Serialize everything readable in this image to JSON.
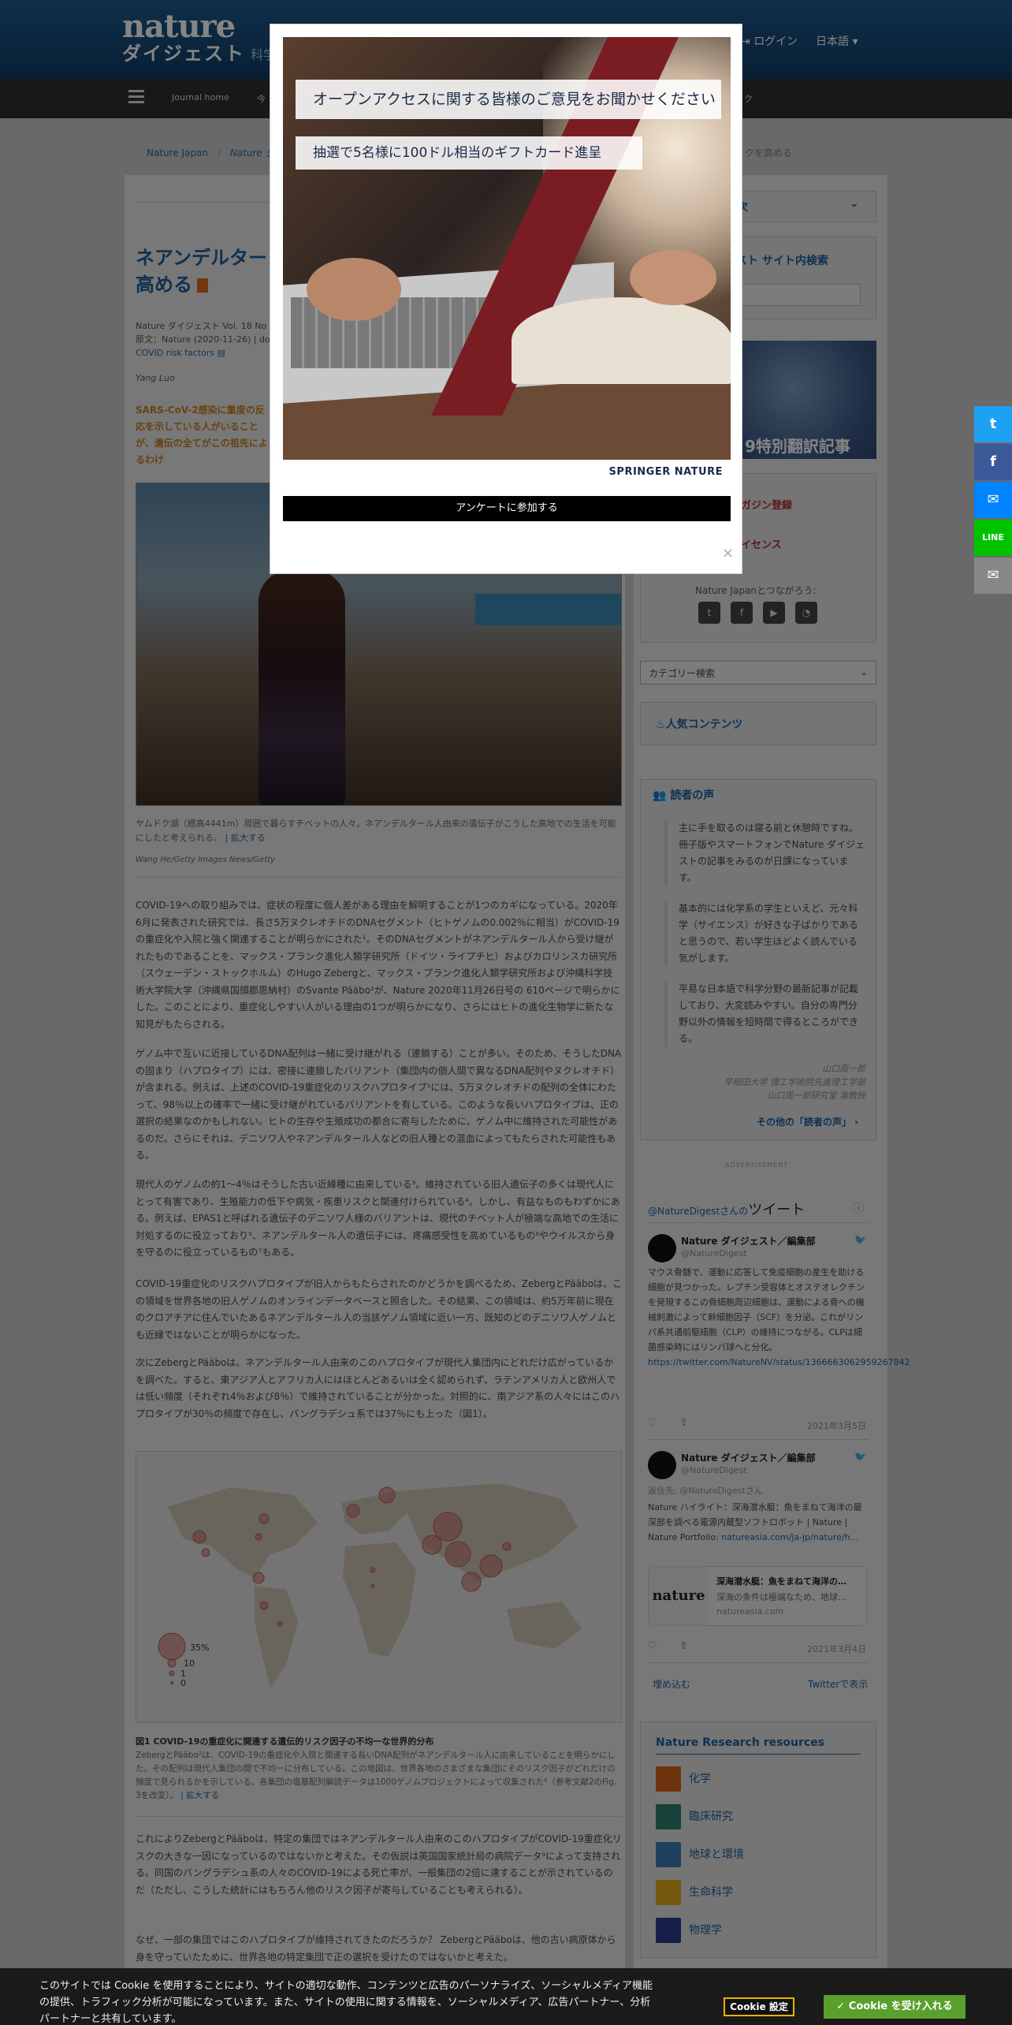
{
  "header": {
    "logo_line1": "nature",
    "logo_line2": "ダイジェスト",
    "sub": "科学",
    "login": "ログイン",
    "lang": "日本語 ▾"
  },
  "nav": {
    "items": [
      "Journal home",
      "今"
    ],
    "right_item": "ク"
  },
  "breadcrumb": {
    "items": [
      "Nature Japan",
      "Nature ダ"
    ],
    "right": "クを高める"
  },
  "article": {
    "title": "ネアンデルター",
    "title_line2": "高める",
    "meta_line1": "Nature ダイジェスト Vol. 18 No",
    "meta_line2": "原文：Nature (2020-11-26) | do",
    "meta_tag": "COVID risk factors",
    "author": "Yang Luo",
    "lead": "SARS-CoV-2感染に重度の反応を示している人がいることが、遺伝の全てがこの祖先によるわけ",
    "caption": "ヤムドク湖（標高4441m）周囲で暮らすチベットの人々。ネアンデルタール人由来の遺伝子がこうした高地での生活を可能にしたと考えられる。",
    "caption_link": "| 拡大する",
    "credit": "Wang He/Getty Images News/Getty",
    "p1": "COVID-19への取り組みでは、症状の程度に個人差がある理由を解明することが1つのカギになっている。2020年6月に発表された研究では、長さ5万ヌクレオチドのDNAセグメント（ヒトゲノムの0.002％に相当）がCOVID-19の重症化や入院と強く関連することが明らかにされた¹。そのDNAセグメントがネアンデルタール人から受け継がれたものであることを、マックス・プランク進化人類学研究所（ドイツ・ライプチヒ）およびカロリンスカ研究所（スウェーデン・ストックホルム）のHugo Zebergと、マックス・プランク進化人類学研究所および沖縄科学技術大学院大学（沖縄県国頭郡恩納村）のSvante Pääbo²が、Nature 2020年11月26日号の 610ページで明らかにした。このことにより、重症化しやすい人がいる理由の1つが明らかになり、さらにはヒトの進化生物学に新たな知見がもたらされる。",
    "p2": "ゲノム中で互いに近接しているDNA配列は一緒に受け継がれる（連鎖する）ことが多い。そのため、そうしたDNAの固まり（ハプロタイプ）には、密接に連鎖したバリアント（集団内の個人間で異なるDNA配列やヌクレオチド）が含まれる。例えば、上述のCOVID-19重症化のリスクハプロタイプ¹には、5万ヌクレオチドの配列の全体にわたって、98％以上の確率で一緒に受け継がれているバリアントを有している。このような長いハプロタイプは、正の選択の結果なのかもしれない。ヒトの生存や生殖成功の都合に寄与したために、ゲノム中に維持された可能性があるのだ。さらにそれは、デニソワ人やネアンデルタール人などの旧人種との混血によってもたらされた可能性もある。",
    "p3": "現代人のゲノムの約1〜4％はそうした古い近縁種に由来している³。維持されている旧人遺伝子の多くは現代人にとって有害であり、生殖能力の低下や病気・疾患リスクと関連付けられている⁴。しかし、有益なものもわずかにある。例えば、EPAS1と呼ばれる遺伝子のデニソワ人様のバリアントは、現代のチベット人が極端な高地での生活に対処するのに役立っており⁵、ネアンデルタール人の遺伝子には、疼痛感受性を高めているもの⁶やウイルスから身を守るのに役立っているもの⁷もある。",
    "p4": "COVID-19重症化のリスクハプロタイプが旧人からもたらされたのかどうかを調べるため、ZebergとPääboは、この領域を世界各地の旧人ゲノムのオンラインデータベースと照合した。その結果、この領域は、約5万年前に現在のクロアチアに住んでいたあるネアンデルタール人の当該ゲノム領域に近い一方、既知のどのデニソワ人ゲノムとも近縁ではないことが明らかになった。",
    "p5": "次にZebergとPääboは、ネアンデルタール人由来のこのハプロタイプが現代人集団内にどれだけ広がっているかを調べた。すると、東アジア人とアフリカ人にはほとんどあるいは全く認められず、ラテンアメリカ人と欧州人では低い頻度（それぞれ4％および8％）で維持されていることが分かった。対照的に、南アジア系の人々にはこのハプロタイプが30％の頻度で存在し、バングラデシュ系では37％にも上った（図1）。",
    "fig_title": "図1 COVID-19の重症化に関連する遺伝的リスク因子の不均一な世界的分布",
    "fig_caption": "ZebergとPääbo²は、COVID-19の重症化や入院と関連する長いDNA配列がネアンデルタール人に由来していることを明らかにした。その配列は現代人集団の間で不均一に分布している。この地図は、世界各地のさまざまな集団にそのリスク因子がどれだけの頻度で見られるかを示している。各集団の塩基配列解読データは1000ゲノムプロジェクトによって収集された⁸（参考文献2のFig. 3を改変）。",
    "fig_link": "| 拡大する",
    "p6": "これによりZebergとPääboは、特定の集団ではネアンデルタール人由来のこのハプロタイプがCOVID-19重症化リスクの大きな一因になっているのではないかと考えた。その仮説は英国国家統計局の病院データ⁹によって支持される。同国のバングラデシュ系の人々のCOVID-19による死亡率が、一般集団の2倍に達することが示されているのだ（ただし、こうした統計にはもちろん他のリスク因子が寄与していることも考えられる）。",
    "p7": "なぜ、一部の集団ではこのハプロタイプが維持されてきたのだろうか？ ZebergとPääboは、他の古い病原体から身を守っていたために、世界各地の特定集団で正の選択を受けたのではないかと考えた。"
  },
  "map_legend": [
    "35%",
    "10",
    "1",
    "0"
  ],
  "sidebar": {
    "toc_label": "次",
    "search_heading": "ェスト サイト内検索",
    "banner_text": "9特別翻訳記事",
    "link1": "ガジン登録",
    "link2": "イセンス",
    "connect": "Nature Japanとつながろう:",
    "category_select": "カテゴリー検索",
    "popular_heading": "人気コンテンツ",
    "voices_heading": "読者の声",
    "quotes": [
      "主に手を取るのは寝る前と休憩時ですね。冊子版やスマートフォンでNature ダイジェストの記事をみるのが日課になっています。",
      "基本的には化学系の学生といえど、元々科学（サイエンス）が好きな子ばかりであると思うので、若い学生ほどよく読んでいる気がします。",
      "平易な日本語で科学分野の最新記事が記載しており、大変読みやすい。自分の専門分野以外の情報を短時間で得るところができる。"
    ],
    "quote_source_1": "山口周一郎",
    "quote_source_2": "早稲田大学 理工学術院先進理工学部",
    "quote_source_3": "山口周一郎研究室 准教授",
    "more_voices": "その他の「読者の声」 ›",
    "advertisement": "ADVERTISEMENT"
  },
  "twitter": {
    "at_handle": "@NatureDigestさんの",
    "title": "ツイート",
    "tweet1_name": "Nature ダイジェスト／編集部",
    "tweet1_handle": "@NatureDigest",
    "tweet1_text": "マウス骨髄で、運動に応答して免疫細胞の産生を助ける細胞が見つかった。レプチン受容体とオステオレクチンを発現するこの骨細胞周辺細胞は、運動による骨への機械刺激によって幹細胞因子（SCF）を分泌。これがリンパ系共通前駆細胞（CLP）の維持につながる。CLPは細菌感染時にはリンパ球へと分化。",
    "tweet1_link": "https://twitter.com/NatureNV/status/1366663062959267842",
    "tweet1_date": "2021年3月5日",
    "tweet2_name": "Nature ダイジェスト／編集部",
    "tweet2_handle": "@NatureDigest",
    "tweet2_reply": "返信先: @NatureDigestさん",
    "tweet2_text": "Nature ハイライト：深海潜水艇：魚をまねて海洋の最深部を調べる電源内蔵型ソフトロボット | Nature | Nature Portfolio:",
    "tweet2_link": "natureasia.com/ja-jp/nature/h…",
    "card_logo": "nature",
    "card_title": "深海潜水艇：魚をまねて海洋の…",
    "card_desc": "深海の条件は極端なため、地球…",
    "card_domain": "natureasia.com",
    "tweet2_date": "2021年3月4日",
    "embed": "埋め込む",
    "view_on": "Twitterで表示"
  },
  "resources": {
    "heading": "Nature Research resources",
    "items": [
      "化学",
      "臨床研究",
      "地球と環境",
      "生命科学",
      "物理学"
    ],
    "colors": [
      "#d4641c",
      "#2e7e6e",
      "#3b7bb3",
      "#e0a81c",
      "#2b3a8c"
    ]
  },
  "share": {
    "buttons": [
      "twitter-icon",
      "facebook-icon",
      "messenger-icon",
      "line-icon",
      "email-icon"
    ],
    "colors": [
      "#1da1f2",
      "#3b5998",
      "#0084ff",
      "#00c300",
      "#888888"
    ]
  },
  "modal": {
    "heading1": "オープンアクセスに関する皆様のご意見をお聞かせください",
    "heading2": "抽選で5名様に100ドル相当のギフトカード進呈",
    "brand": "SPRINGER NATURE",
    "button": "アンケートに参加する",
    "close": "×"
  },
  "cookie": {
    "text": "このサイトでは Cookie を使用することにより、サイトの適切な動作、コンテンツと広告のパーソナライズ、ソーシャルメディア機能の提供、トラフィック分析が可能になっています。また、サイトの使用に関する情報を、ソーシャルメディア、広告パートナー、分析パートナーと共有しています。",
    "settings": "Cookie 設定",
    "accept": "✓ Cookie を受け入れる"
  }
}
